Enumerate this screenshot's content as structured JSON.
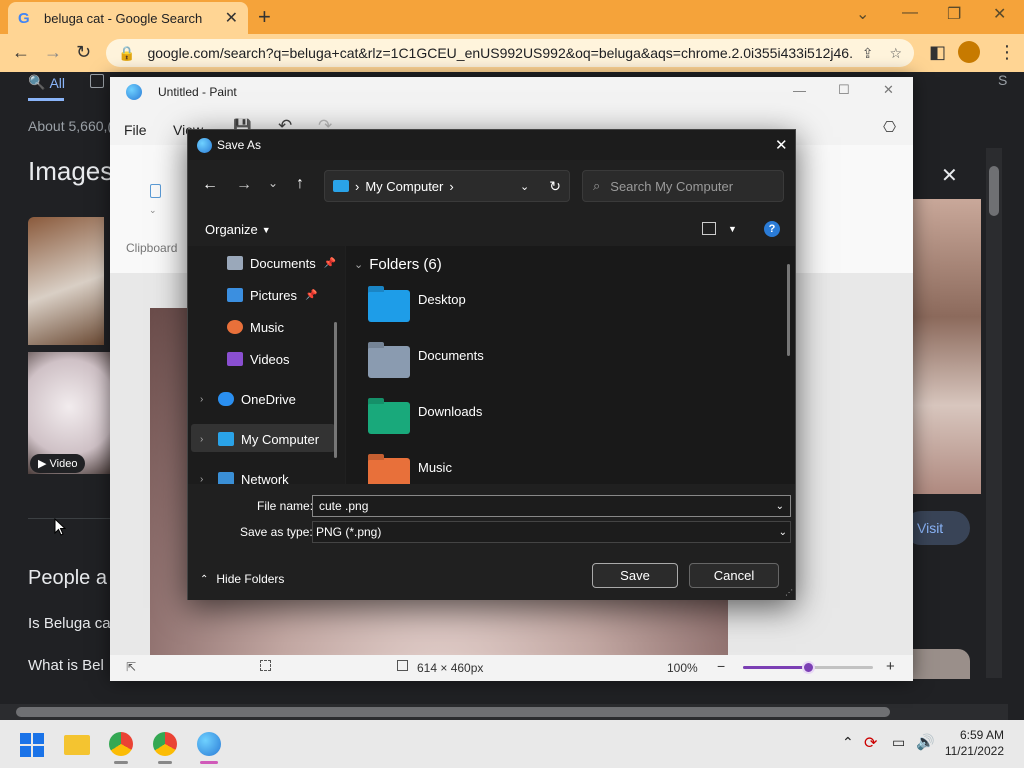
{
  "browser": {
    "tab_title": "beluga cat - Google Search",
    "url": "google.com/search?q=beluga+cat&rlz=1C1GCEU_enUS992US992&oq=beluga&aqs=chrome.2.0i355i433i512j46...",
    "new_tab": "+",
    "icons": [
      "back-icon",
      "forward-icon",
      "reload-icon",
      "lock-icon",
      "share-icon",
      "star-icon",
      "sidebar-icon",
      "profile-icon",
      "menu-icon"
    ]
  },
  "google": {
    "tab_all": "All",
    "result_count": "About 5,660,(",
    "images_heading": "Images",
    "video_badge": "▶ Video",
    "people_heading": "People a",
    "question1": "Is Beluga ca",
    "question2": "What is Bel",
    "visit_button": "Visit",
    "s_partial": "S"
  },
  "paint": {
    "title": "Untitled - Paint",
    "menu_file": "File",
    "menu_view": "View",
    "ribbon_label": "Clipboard",
    "canvas_size": "614 × 460px",
    "zoom": "100%",
    "zoom_level": 0.5
  },
  "dialog": {
    "title": "Save As",
    "breadcrumb": "My Computer",
    "search_placeholder": "Search My Computer",
    "organize": "Organize",
    "nav": [
      {
        "label": "Documents",
        "pinned": true
      },
      {
        "label": "Pictures",
        "pinned": true
      },
      {
        "label": "Music"
      },
      {
        "label": "Videos"
      },
      {
        "label": "OneDrive"
      },
      {
        "label": "My Computer"
      },
      {
        "label": "Network"
      }
    ],
    "folders_header": "Folders (6)",
    "folders": [
      {
        "label": "Desktop",
        "color": "#1e9de8"
      },
      {
        "label": "Documents",
        "color": "#8a9bb0"
      },
      {
        "label": "Downloads",
        "color": "#19a97b"
      },
      {
        "label": "Music",
        "color": "#e8703a"
      }
    ],
    "file_name_label": "File name:",
    "file_name_value": "cute .png",
    "save_type_label": "Save as type:",
    "save_type_value": "PNG (*.png)",
    "hide_folders": "Hide Folders",
    "save": "Save",
    "cancel": "Cancel"
  },
  "taskbar": {
    "time": "6:59 AM",
    "date": "11/21/2022"
  }
}
